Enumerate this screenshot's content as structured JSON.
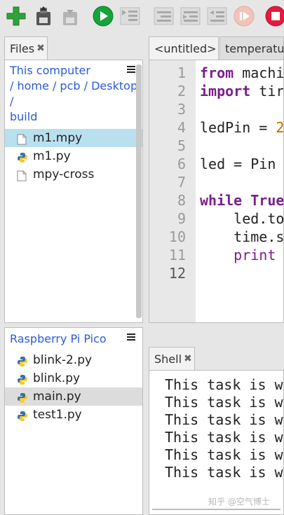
{
  "toolbar": {
    "buttons": [
      "new-file",
      "save-file",
      "save-to-device",
      "run",
      "debug",
      "step-over",
      "step-into",
      "step-out",
      "resume",
      "stop"
    ],
    "colors": {
      "run": "#14a43a",
      "new": "#2ea33a",
      "stop": "#e21b3c"
    }
  },
  "files": {
    "tab_label": "Files",
    "tab_close": "✖",
    "computer": {
      "header": {
        "this_computer": "This computer",
        "sep1": "/",
        "home": "home",
        "sep2": "/",
        "pcb": "pcb",
        "sep3": "/",
        "desktop": "Desktop",
        "sep4": "/",
        "build": "build"
      },
      "items": [
        {
          "name": "m1.mpy",
          "type": "file",
          "selected": true
        },
        {
          "name": "m1.py",
          "type": "python"
        },
        {
          "name": "mpy-cross",
          "type": "file"
        }
      ]
    },
    "device": {
      "header": "Raspberry Pi Pico",
      "items": [
        {
          "name": "blink-2.py",
          "type": "python"
        },
        {
          "name": "blink.py",
          "type": "python"
        },
        {
          "name": "main.py",
          "type": "python",
          "selected": true
        },
        {
          "name": "test1.py",
          "type": "python"
        }
      ]
    }
  },
  "editor": {
    "tabs": [
      {
        "label": "<untitled>",
        "close": "✖",
        "active": true
      },
      {
        "label": "temperature",
        "active": false
      }
    ],
    "line_numbers": [
      "1",
      "2",
      "3",
      "4",
      "5",
      "6",
      "7",
      "8",
      "9",
      "10",
      "11",
      "12"
    ],
    "current_line": "12",
    "code": {
      "l1_kw": "from",
      "l1_rest": " machi",
      "l2_kw": "import",
      "l2_rest": " tir",
      "l4_rest": "ledPin = ",
      "l4_num": "2",
      "l6_rest": "led = Pin",
      "l8_kw": "while",
      "l8_kw2": " True",
      "l9_rest": "    led.to",
      "l10_rest": "    time.s",
      "l11_fn": "    print"
    }
  },
  "shell": {
    "tab_label": "Shell",
    "tab_close": "✖",
    "lines": [
      "This task is w",
      "This task is w",
      "This task is w",
      "This task is w",
      "This task is w",
      "This task is w"
    ],
    "watermark": "知乎 @空气博士"
  }
}
